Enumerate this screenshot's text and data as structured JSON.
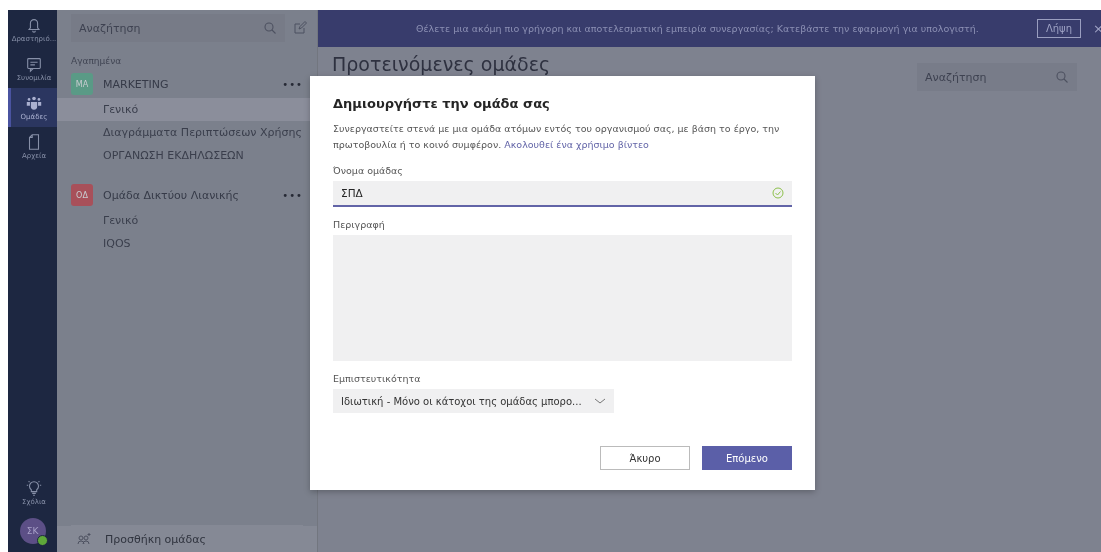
{
  "rail": {
    "items": [
      {
        "label": "Δραστηριό...",
        "kind": "bell",
        "selected": false
      },
      {
        "label": "Συνομιλία",
        "kind": "chat",
        "selected": false
      },
      {
        "label": "Ομάδες",
        "kind": "teams",
        "selected": true
      },
      {
        "label": "Αρχεία",
        "kind": "file",
        "selected": false
      }
    ],
    "bottom_items": [
      {
        "label": "Σχόλια",
        "kind": "bulb",
        "selected": false
      }
    ],
    "avatar": {
      "initials": "ΣΚ",
      "online": true
    }
  },
  "sidebar": {
    "search": {
      "placeholder": "Αναζήτηση"
    },
    "section_label": "Αγαπημένα",
    "teams": [
      {
        "initials": "MA",
        "name": "MARKETING",
        "color": "#5a9a86",
        "more": "•••",
        "channels": [
          {
            "name": "Γενικό",
            "selected": true
          },
          {
            "name": "Διαγράμματα Περιπτώσεων Χρήσης",
            "selected": false
          },
          {
            "name": "ΟΡΓΑΝΩΣΗ ΕΚΔΗΛΩΣΕΩΝ",
            "selected": false
          }
        ]
      },
      {
        "initials": "ΟΔ",
        "name": "Ομάδα Δικτύου Λιανικής",
        "color": "#a8505a",
        "more": "•••",
        "channels": [
          {
            "name": "Γενικό",
            "selected": false
          },
          {
            "name": "IQOS",
            "selected": false
          }
        ]
      }
    ],
    "add_team": "Προσθήκη ομάδας"
  },
  "banner": {
    "text": "Θέλετε μια ακόμη πιο γρήγορη και αποτελεσματική εμπειρία συνεργασίας; Κατεβάστε την εφαρμογή για υπολογιστή.",
    "button": "Λήψη",
    "close": "×"
  },
  "main": {
    "heading": "Προτεινόμενες ομάδες",
    "search": {
      "placeholder": "Αναζήτηση"
    }
  },
  "dialog": {
    "title": "Δημιουργήστε την ομάδα σας",
    "description": "Συνεργαστείτε στενά με μια ομάδα ατόμων εντός του οργανισμού σας, με βάση το έργο, την πρωτοβουλία ή το κοινό συμφέρον.",
    "link": "Ακολουθεί ένα χρήσιμο βίντεο",
    "name_field": {
      "label": "Όνομα ομάδας",
      "value": "ΣΠΔ",
      "valid": true,
      "focused": true
    },
    "description_field": {
      "label": "Περιγραφή"
    },
    "privacy_field": {
      "label": "Εμπιστευτικότητα",
      "value": "Ιδιωτική - Μόνο οι κάτοχοι της ομάδας μπορο..."
    },
    "buttons": [
      {
        "label": "Άκυρο",
        "kind": "secondary"
      },
      {
        "label": "Επόμενο",
        "kind": "primary"
      }
    ]
  }
}
